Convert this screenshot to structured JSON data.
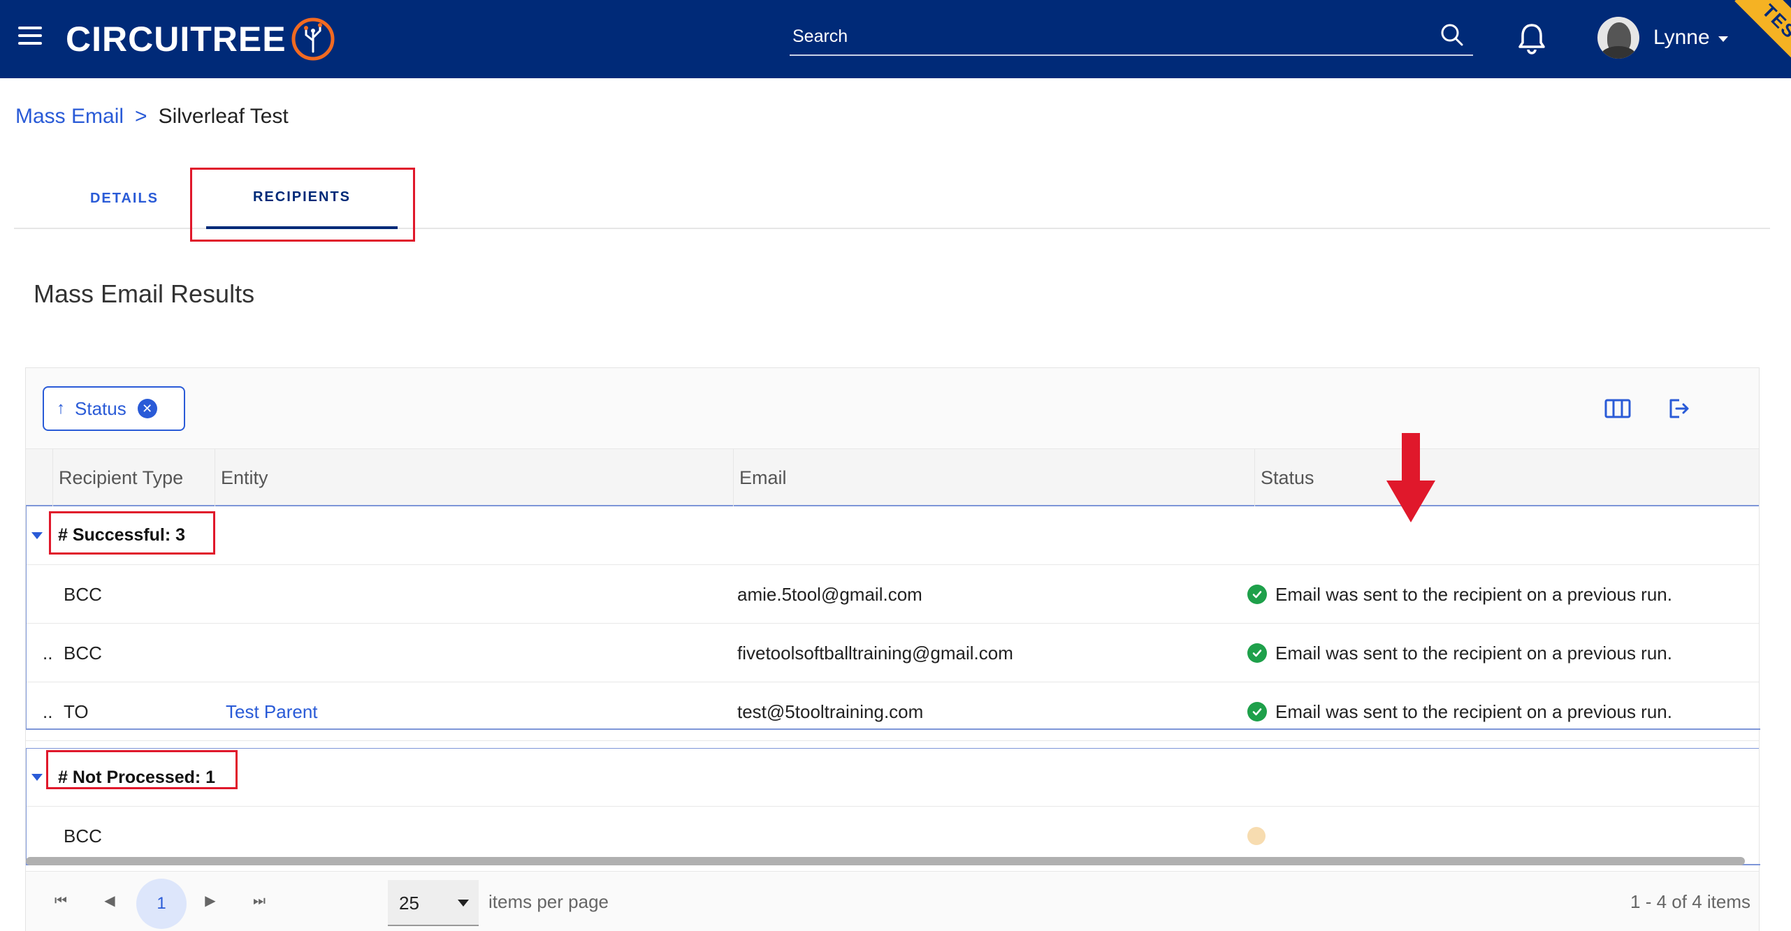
{
  "header": {
    "brand": "CIRCUITREE",
    "search_placeholder": "Search",
    "user_name": "Lynne",
    "env_badge": "TEST",
    "colors": {
      "bar": "#002a78",
      "accent": "#f5b223"
    }
  },
  "breadcrumb": {
    "parent": "Mass Email",
    "separator": ">",
    "current": "Silverleaf Test"
  },
  "tabs": [
    {
      "label": "DETAILS",
      "active": false
    },
    {
      "label": "RECIPIENTS",
      "active": true
    }
  ],
  "section_title": "Mass Email Results",
  "grid": {
    "group_chip": {
      "label": "Status",
      "sort": "ascending"
    },
    "columns": [
      "Recipient Type",
      "Entity",
      "Email",
      "Status"
    ],
    "groups": [
      {
        "label": "# Successful: 3",
        "rows": [
          {
            "prefix": "",
            "type": "BCC",
            "entity": "",
            "email": "amie.5tool@gmail.com",
            "status": "Email was sent to the recipient on a previous run.",
            "status_icon": "check-circle-icon"
          },
          {
            "prefix": "..",
            "type": "BCC",
            "entity": "",
            "email": "fivetoolsoftballtraining@gmail.com",
            "status": "Email was sent to the recipient on a previous run.",
            "status_icon": "check-circle-icon"
          },
          {
            "prefix": "..",
            "type": "TO",
            "entity": "Test Parent",
            "email": "test@5tooltraining.com",
            "status": "Email was sent to the recipient on a previous run.",
            "status_icon": "check-circle-icon"
          }
        ]
      },
      {
        "label": "# Not Processed: 1",
        "rows": [
          {
            "prefix": "",
            "type": "BCC",
            "entity": "",
            "email": "",
            "status": "",
            "status_icon": "pending-dot-icon"
          }
        ]
      }
    ]
  },
  "pager": {
    "current_page": "1",
    "page_size": "25",
    "page_size_label": "items per page",
    "info": "1 - 4 of 4 items"
  }
}
